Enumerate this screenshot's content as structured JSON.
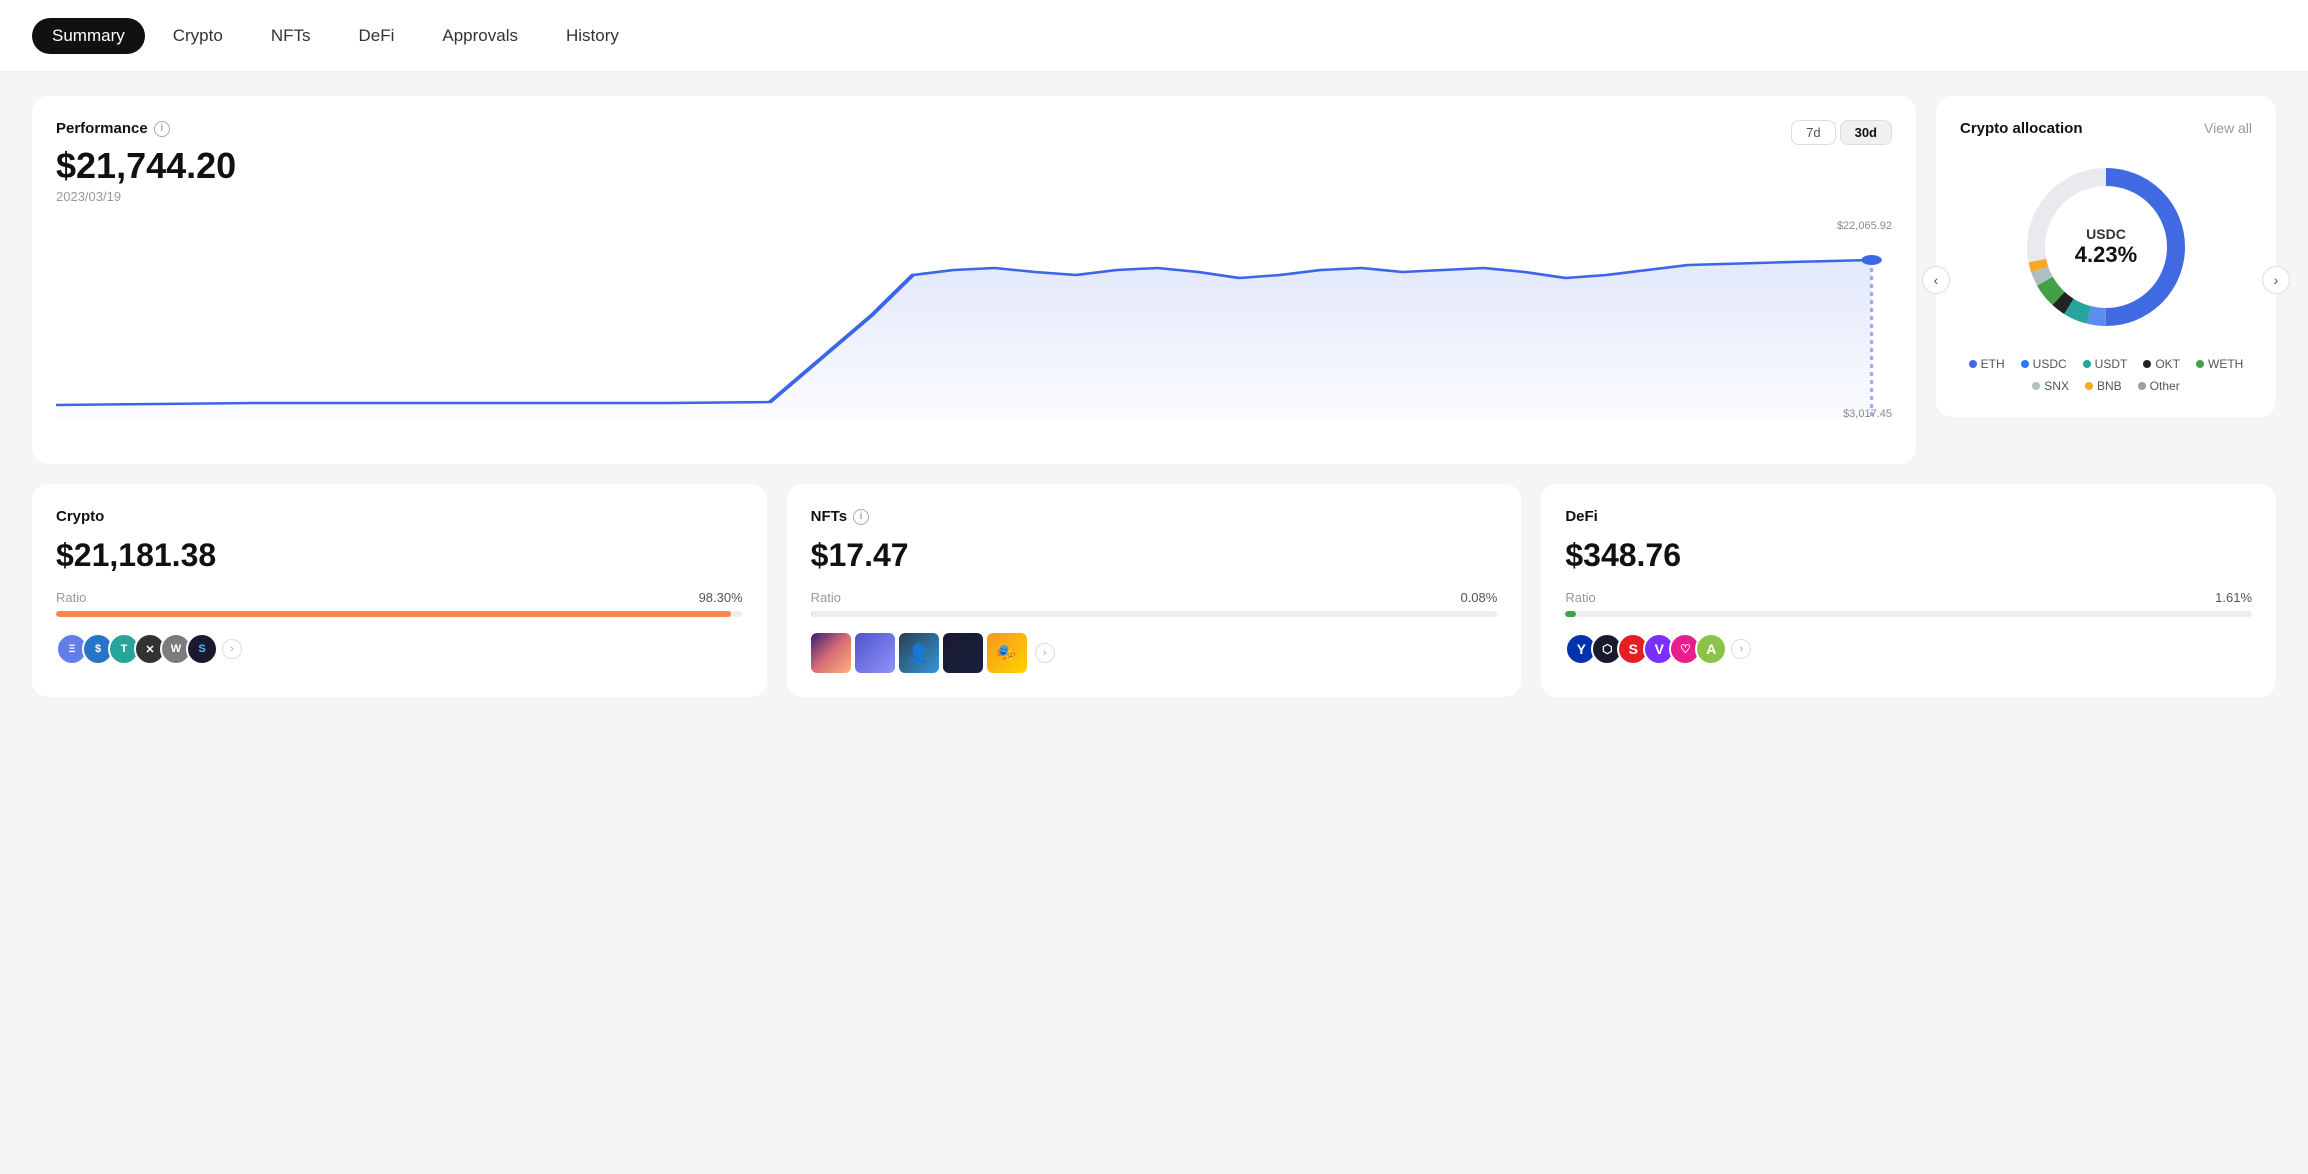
{
  "nav": {
    "items": [
      {
        "label": "Summary",
        "active": true
      },
      {
        "label": "Crypto",
        "active": false
      },
      {
        "label": "NFTs",
        "active": false
      },
      {
        "label": "DeFi",
        "active": false
      },
      {
        "label": "Approvals",
        "active": false
      },
      {
        "label": "History",
        "active": false
      }
    ]
  },
  "performance": {
    "title": "Performance",
    "amount": "$21,744.20",
    "date": "2023/03/19",
    "high_label": "$22,065.92",
    "low_label": "$3,017.45",
    "time_buttons": [
      "7d",
      "30d"
    ],
    "active_time": "30d"
  },
  "allocation": {
    "title": "Crypto allocation",
    "view_all": "View all",
    "center_coin": "USDC",
    "center_pct": "4.23%",
    "legend": [
      {
        "label": "ETH",
        "color": "#4169e1"
      },
      {
        "label": "USDC",
        "color": "#2979ff"
      },
      {
        "label": "USDT",
        "color": "#26a69a"
      },
      {
        "label": "OKT",
        "color": "#222"
      },
      {
        "label": "WETH",
        "color": "#43a047"
      },
      {
        "label": "SNX",
        "color": "#b0bec5"
      },
      {
        "label": "BNB",
        "color": "#f9a825"
      },
      {
        "label": "Other",
        "color": "#9e9e9e"
      }
    ]
  },
  "cards": {
    "crypto": {
      "title": "Crypto",
      "amount": "$21,181.38",
      "ratio_label": "Ratio",
      "ratio_value": "98.30%",
      "progress_pct": 98.3,
      "progress_color": "#f5874f"
    },
    "nfts": {
      "title": "NFTs",
      "amount": "$17.47",
      "ratio_label": "Ratio",
      "ratio_value": "0.08%",
      "progress_pct": 0.08,
      "progress_color": "#e0e0e0"
    },
    "defi": {
      "title": "DeFi",
      "amount": "$348.76",
      "ratio_label": "Ratio",
      "ratio_value": "1.61%",
      "progress_pct": 1.61,
      "progress_color": "#43a047"
    }
  },
  "icons": {
    "chevron_left": "‹",
    "chevron_right": "›",
    "info": "i"
  }
}
